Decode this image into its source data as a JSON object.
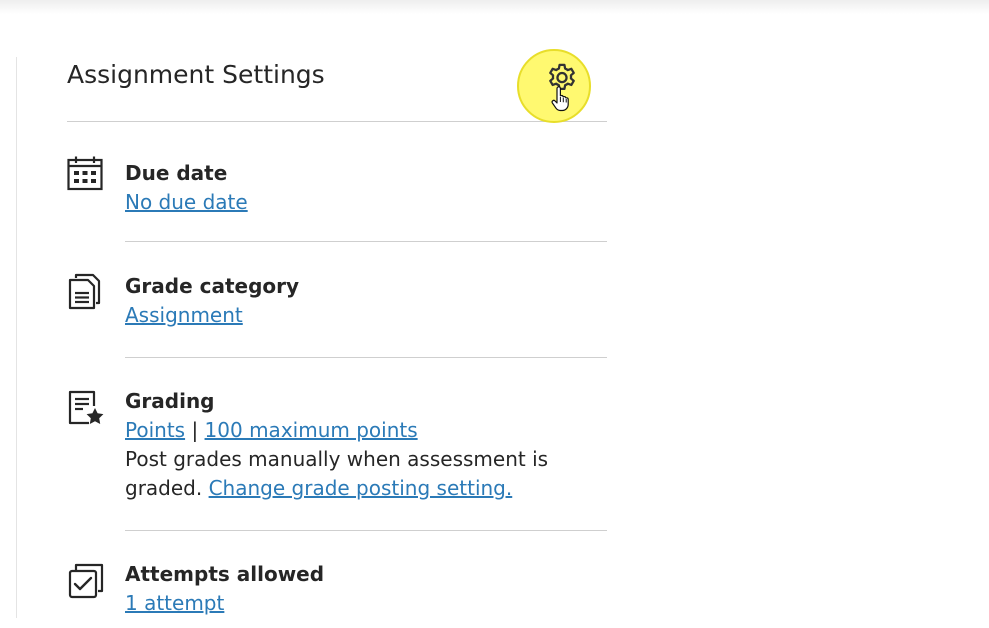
{
  "panel": {
    "title": "Assignment Settings"
  },
  "settings": [
    {
      "label": "Due date",
      "value": "No due date"
    },
    {
      "label": "Grade category",
      "value": "Assignment"
    },
    {
      "label": "Grading",
      "value_type": "Points",
      "separator": "|",
      "value_points": "100 maximum points",
      "note_line1": "Post grades manually when assessment is",
      "note_line2": "graded.",
      "note_link": "Change grade posting setting."
    },
    {
      "label": "Attempts allowed",
      "value": "1 attempt"
    }
  ],
  "colors": {
    "link": "#2b7ab7",
    "text": "#262626",
    "highlight": "#fff740"
  },
  "icons": [
    "settings-gear-icon",
    "calendar-icon",
    "document-icon",
    "grading-star-icon",
    "checkbox-stack-icon",
    "hand-pointer-cursor-icon"
  ]
}
